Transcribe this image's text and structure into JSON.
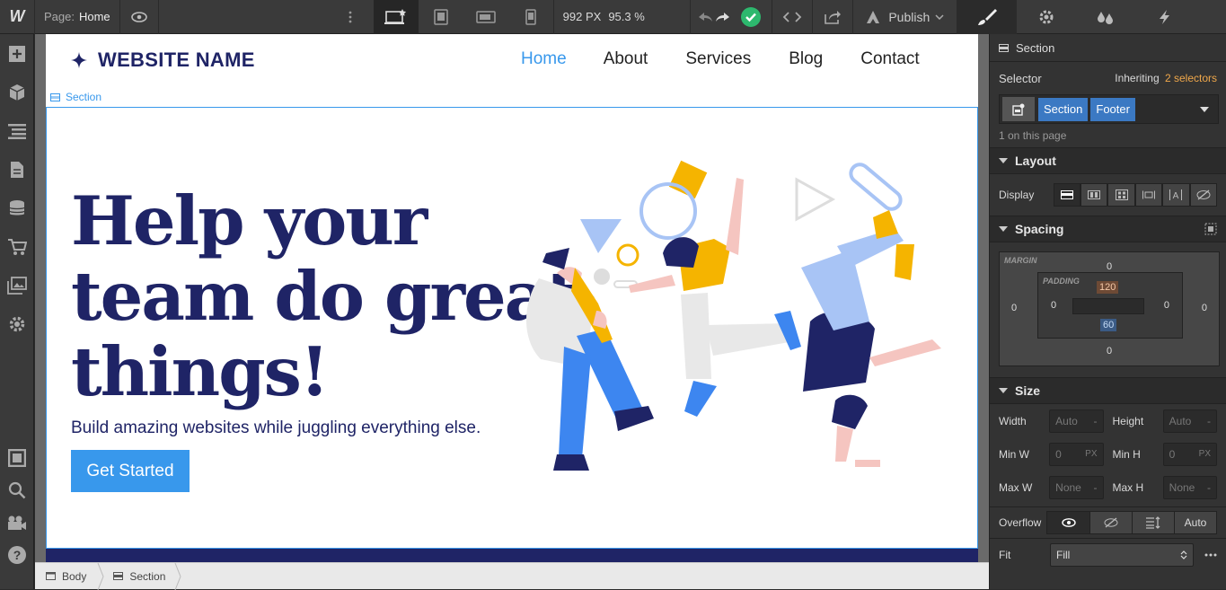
{
  "topbar": {
    "logo": "W",
    "page_label": "Page:",
    "page_name": "Home",
    "width_value": "992 PX",
    "zoom": "95.3 %",
    "publish": "Publish"
  },
  "site": {
    "brand": "WEBSITE NAME",
    "nav": [
      "Home",
      "About",
      "Services",
      "Blog",
      "Contact"
    ],
    "section_tag": "Section",
    "headline_1": "Help your",
    "headline_2": "team do great",
    "headline_3": "things!",
    "subtitle": "Build amazing websites while juggling everything else.",
    "cta": "Get Started"
  },
  "breadcrumb": [
    "Body",
    "Section"
  ],
  "panel": {
    "element": "Section",
    "selector_label": "Selector",
    "inheriting_text": "Inheriting",
    "inheriting_count": "2 selectors",
    "classes": [
      "Section",
      "Footer"
    ],
    "on_page": "1 on this page",
    "layout_title": "Layout",
    "display_label": "Display",
    "spacing_title": "Spacing",
    "margin_label": "MARGIN",
    "padding_label": "PADDING",
    "margin": {
      "top": "0",
      "right": "0",
      "bottom": "0",
      "left": "0"
    },
    "padding": {
      "top": "120",
      "right": "0",
      "bottom": "60",
      "left": "0"
    },
    "size_title": "Size",
    "width_label": "Width",
    "width_value": "Auto",
    "height_label": "Height",
    "height_value": "Auto",
    "minw_label": "Min W",
    "minw_value": "0",
    "minh_label": "Min H",
    "minh_value": "0",
    "unit_px": "PX",
    "maxw_label": "Max W",
    "maxw_value": "None",
    "maxh_label": "Max H",
    "maxh_value": "None",
    "dash": "-",
    "overflow_label": "Overflow",
    "overflow_auto": "Auto",
    "fit_label": "Fit",
    "fit_value": "Fill"
  },
  "colors": {
    "accent": "#3898ec",
    "navy": "#1f2466",
    "orange": "#f0a84b",
    "green": "#2db86e"
  }
}
